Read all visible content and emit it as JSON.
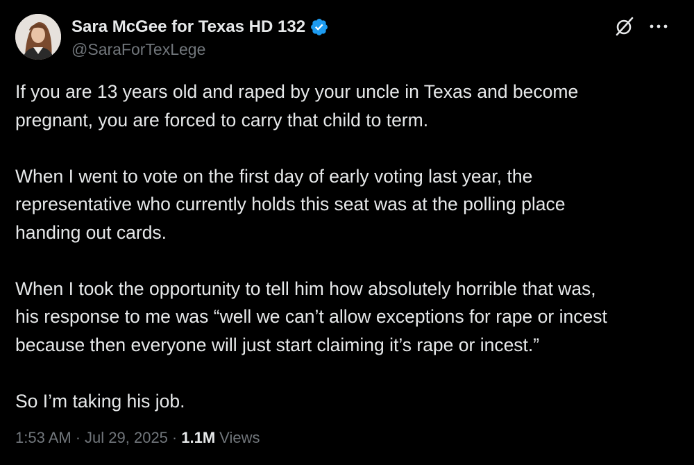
{
  "author": {
    "name": "Sara McGee for Texas HD 132",
    "handle": "@SaraForTexLege",
    "verified": true,
    "verified_color": "#1d9bf0"
  },
  "icons": {
    "grok": "grok-icon",
    "more": "more-horizontal-icon",
    "verified": "verified-badge-icon"
  },
  "tweet": {
    "paragraphs": [
      "If you are 13 years old and raped by your uncle in Texas and become\npregnant, you are forced to carry that child to term.",
      "When I went to vote on the first day of early voting last year, the\nrepresentative who currently holds this seat was at the polling place\nhanding out cards.",
      "When I took the opportunity to tell him how absolutely horrible that was,\nhis response to me was “well we can’t allow exceptions for rape or incest\nbecause then everyone will just start claiming it’s rape or incest.”",
      "So I’m taking his job."
    ]
  },
  "meta": {
    "time": "1:53 AM",
    "separator": "·",
    "date": "Jul 29, 2025",
    "views_count": "1.1M",
    "views_label": "Views"
  },
  "colors": {
    "background": "#000000",
    "text": "#e7e9ea",
    "secondary": "#71767b"
  }
}
